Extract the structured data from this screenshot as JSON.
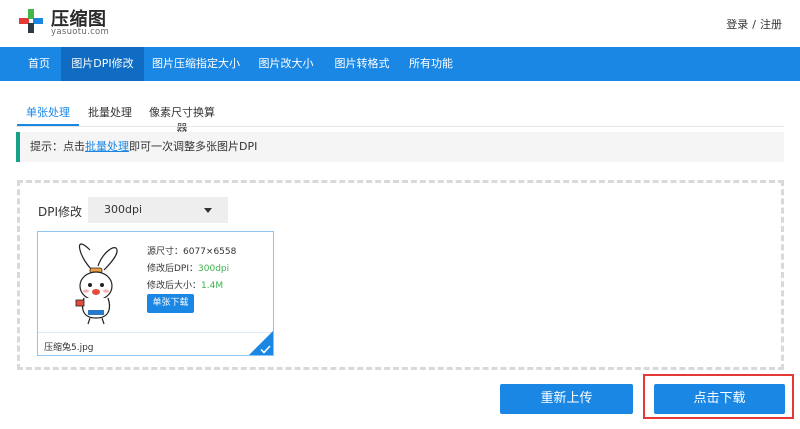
{
  "brand": {
    "name": "压缩图",
    "url": "yasuotu.com",
    "colors": {
      "red": "#e53935",
      "blue": "#1a87e4",
      "green": "#43b649",
      "dark": "#333333"
    }
  },
  "auth": {
    "login": "登录",
    "separator": "/",
    "register": "注册"
  },
  "nav": {
    "items": [
      {
        "label": "首页"
      },
      {
        "label": "图片DPI修改"
      },
      {
        "label": "图片压缩指定大小"
      },
      {
        "label": "图片改大小"
      },
      {
        "label": "图片转格式"
      },
      {
        "label": "所有功能"
      }
    ],
    "active_index": 1,
    "color": "#1a87e4"
  },
  "tabs": [
    {
      "label": "单张处理"
    },
    {
      "label": "批量处理"
    },
    {
      "label": "像素尺寸换算器"
    }
  ],
  "tip": {
    "prefix": "提示：点击",
    "link": "批量处理",
    "suffix": "即可一次调整多张图片DPI"
  },
  "dpi": {
    "label": "DPI修改",
    "selected": "300dpi"
  },
  "file": {
    "name": "压缩兔5.jpg",
    "source_label": "源尺寸：",
    "source_value": "6077×6558",
    "dpi_label": "修改后DPI：",
    "dpi_value": "300dpi",
    "size_label": "修改后大小：",
    "size_value": "1.4M",
    "download_label": "单张下载",
    "thumb_icon": "rabbit-mascot-icon",
    "selected": true
  },
  "actions": {
    "reupload": "重新上传",
    "download": "点击下载"
  }
}
